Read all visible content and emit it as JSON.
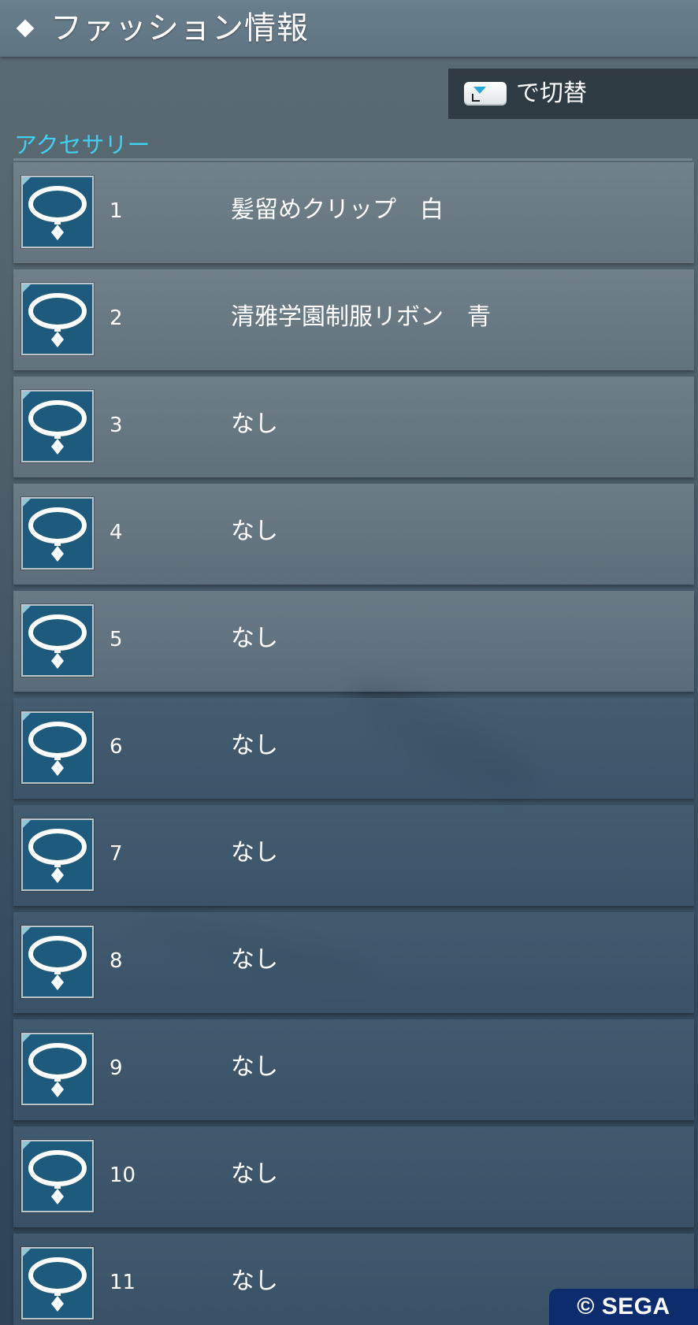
{
  "header": {
    "title": "ファッション情報",
    "marker_icon": "diamond-icon"
  },
  "switch_hint": {
    "key_icon": "touchpad-down-key-icon",
    "label": "で切替"
  },
  "section": {
    "label": "アクセサリー"
  },
  "accessory_icon": "necklace-icon",
  "rows": [
    {
      "num": "1",
      "name": "髪留めクリップ　白"
    },
    {
      "num": "2",
      "name": "清雅学園制服リボン　青"
    },
    {
      "num": "3",
      "name": "なし"
    },
    {
      "num": "4",
      "name": "なし"
    },
    {
      "num": "5",
      "name": "なし"
    },
    {
      "num": "6",
      "name": "なし"
    },
    {
      "num": "7",
      "name": "なし"
    },
    {
      "num": "8",
      "name": "なし"
    },
    {
      "num": "9",
      "name": "なし"
    },
    {
      "num": "10",
      "name": "なし"
    },
    {
      "num": "11",
      "name": "なし"
    }
  ],
  "copyright": "© SEGA",
  "colors": {
    "section_label": "#3fd0f0",
    "icon_bg": "#1d5a7c",
    "copyright_bg": "#0d2c6e"
  }
}
